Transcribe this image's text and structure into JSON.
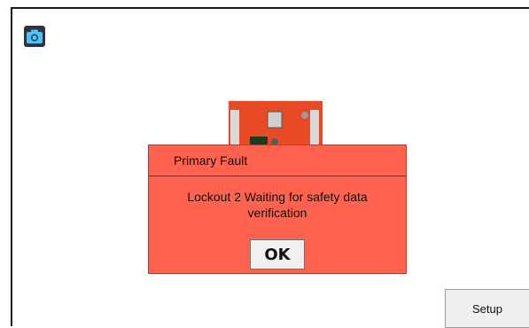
{
  "toolbar": {
    "camera_icon": "camera-icon"
  },
  "dialog": {
    "title": "Primary Fault",
    "message": "Lockout 2 Waiting for safety data verification",
    "ok_label": "OK",
    "background": "#ff634f"
  },
  "footer": {
    "setup_label": "Setup"
  }
}
